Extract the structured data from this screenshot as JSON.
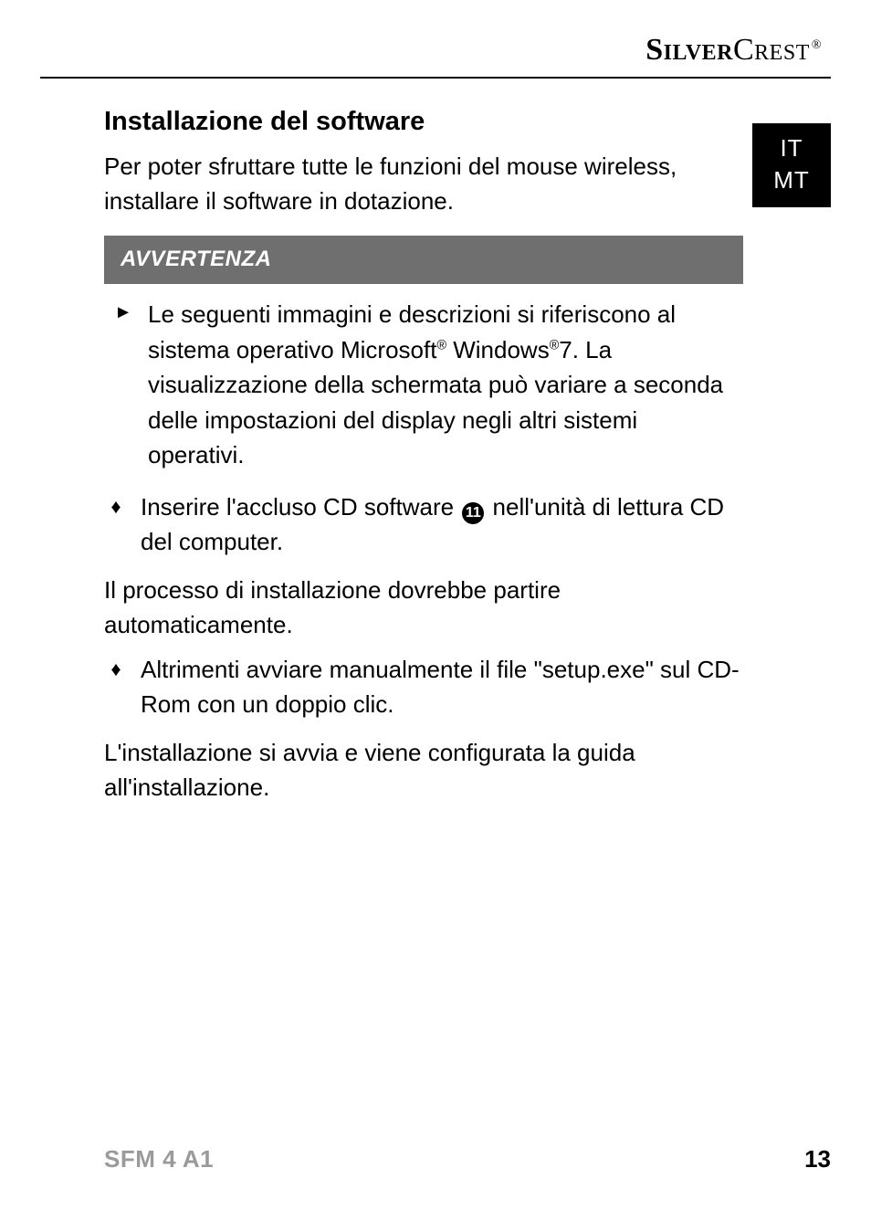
{
  "brand": {
    "part1": "Silver",
    "part2": "Crest",
    "reg": "®"
  },
  "lang_tab": {
    "line1": "IT",
    "line2": "MT"
  },
  "section_title": "Installazione del software",
  "intro": "Per poter sfruttare tutte le funzioni del mouse wireless, installare il software in dotazione.",
  "warn": {
    "header": "AVVERTENZA",
    "item1_pre": "Le seguenti immagini e descrizioni si riferiscono al sistema operativo Microsoft",
    "item1_mid": " Windows",
    "item1_post": "7. La visualizzazione della schermata può variare a seconda delle impostazioni del display negli altri sistemi operativi.",
    "reg": "®"
  },
  "step1": {
    "pre": "Inserire l'accluso CD software ",
    "num": "11",
    "post": " nell'unità di lettura CD del computer."
  },
  "para2": "Il processo di installazione dovrebbe partire automaticamente.",
  "step2": "Altrimenti avviare manualmente il file \"setup.exe\" sul CD-Rom con un doppio clic.",
  "para3": "L'installazione si avvia e viene configurata la guida all'installazione.",
  "footer": {
    "model": "SFM 4 A1",
    "page": "13"
  },
  "markers": {
    "arrow": "►",
    "diamond": "♦"
  }
}
